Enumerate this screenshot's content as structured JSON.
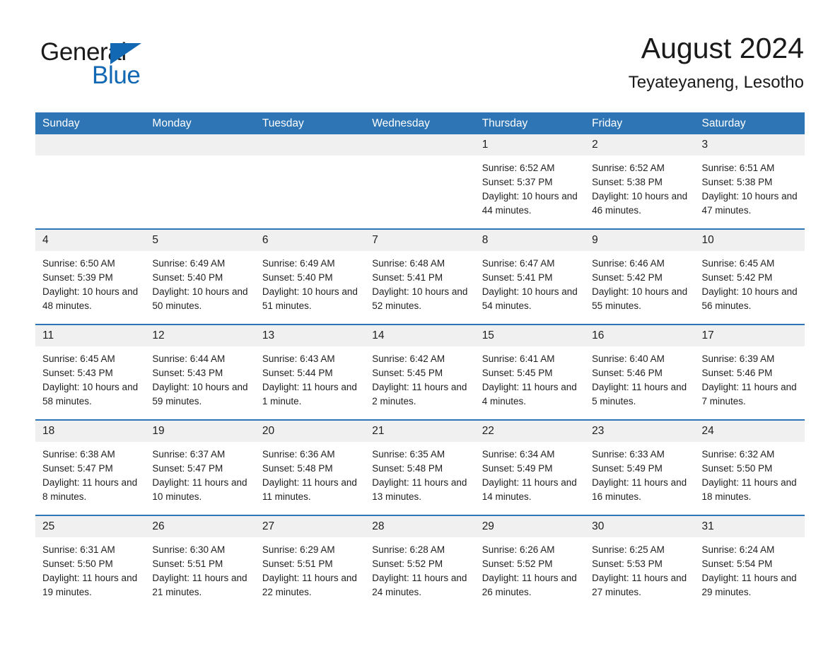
{
  "logo": {
    "word_one": "General",
    "word_two": "Blue",
    "triangle_color": "#1268b3",
    "text_color": "#1a1a1a"
  },
  "header": {
    "title": "August 2024",
    "subtitle": "Teyateyaneng, Lesotho"
  },
  "theme": {
    "header_blue": "#2e75b6",
    "daynum_band": "#f0f0f0",
    "cell_background": "#ffffff",
    "text": "#1f1f1f"
  },
  "weekday_headers": [
    "Sunday",
    "Monday",
    "Tuesday",
    "Wednesday",
    "Thursday",
    "Friday",
    "Saturday"
  ],
  "weeks": [
    [
      {
        "day": "",
        "sunrise": "",
        "sunset": "",
        "daylight": ""
      },
      {
        "day": "",
        "sunrise": "",
        "sunset": "",
        "daylight": ""
      },
      {
        "day": "",
        "sunrise": "",
        "sunset": "",
        "daylight": ""
      },
      {
        "day": "",
        "sunrise": "",
        "sunset": "",
        "daylight": ""
      },
      {
        "day": "1",
        "sunrise": "Sunrise: 6:52 AM",
        "sunset": "Sunset: 5:37 PM",
        "daylight": "Daylight: 10 hours and 44 minutes."
      },
      {
        "day": "2",
        "sunrise": "Sunrise: 6:52 AM",
        "sunset": "Sunset: 5:38 PM",
        "daylight": "Daylight: 10 hours and 46 minutes."
      },
      {
        "day": "3",
        "sunrise": "Sunrise: 6:51 AM",
        "sunset": "Sunset: 5:38 PM",
        "daylight": "Daylight: 10 hours and 47 minutes."
      }
    ],
    [
      {
        "day": "4",
        "sunrise": "Sunrise: 6:50 AM",
        "sunset": "Sunset: 5:39 PM",
        "daylight": "Daylight: 10 hours and 48 minutes."
      },
      {
        "day": "5",
        "sunrise": "Sunrise: 6:49 AM",
        "sunset": "Sunset: 5:40 PM",
        "daylight": "Daylight: 10 hours and 50 minutes."
      },
      {
        "day": "6",
        "sunrise": "Sunrise: 6:49 AM",
        "sunset": "Sunset: 5:40 PM",
        "daylight": "Daylight: 10 hours and 51 minutes."
      },
      {
        "day": "7",
        "sunrise": "Sunrise: 6:48 AM",
        "sunset": "Sunset: 5:41 PM",
        "daylight": "Daylight: 10 hours and 52 minutes."
      },
      {
        "day": "8",
        "sunrise": "Sunrise: 6:47 AM",
        "sunset": "Sunset: 5:41 PM",
        "daylight": "Daylight: 10 hours and 54 minutes."
      },
      {
        "day": "9",
        "sunrise": "Sunrise: 6:46 AM",
        "sunset": "Sunset: 5:42 PM",
        "daylight": "Daylight: 10 hours and 55 minutes."
      },
      {
        "day": "10",
        "sunrise": "Sunrise: 6:45 AM",
        "sunset": "Sunset: 5:42 PM",
        "daylight": "Daylight: 10 hours and 56 minutes."
      }
    ],
    [
      {
        "day": "11",
        "sunrise": "Sunrise: 6:45 AM",
        "sunset": "Sunset: 5:43 PM",
        "daylight": "Daylight: 10 hours and 58 minutes."
      },
      {
        "day": "12",
        "sunrise": "Sunrise: 6:44 AM",
        "sunset": "Sunset: 5:43 PM",
        "daylight": "Daylight: 10 hours and 59 minutes."
      },
      {
        "day": "13",
        "sunrise": "Sunrise: 6:43 AM",
        "sunset": "Sunset: 5:44 PM",
        "daylight": "Daylight: 11 hours and 1 minute."
      },
      {
        "day": "14",
        "sunrise": "Sunrise: 6:42 AM",
        "sunset": "Sunset: 5:45 PM",
        "daylight": "Daylight: 11 hours and 2 minutes."
      },
      {
        "day": "15",
        "sunrise": "Sunrise: 6:41 AM",
        "sunset": "Sunset: 5:45 PM",
        "daylight": "Daylight: 11 hours and 4 minutes."
      },
      {
        "day": "16",
        "sunrise": "Sunrise: 6:40 AM",
        "sunset": "Sunset: 5:46 PM",
        "daylight": "Daylight: 11 hours and 5 minutes."
      },
      {
        "day": "17",
        "sunrise": "Sunrise: 6:39 AM",
        "sunset": "Sunset: 5:46 PM",
        "daylight": "Daylight: 11 hours and 7 minutes."
      }
    ],
    [
      {
        "day": "18",
        "sunrise": "Sunrise: 6:38 AM",
        "sunset": "Sunset: 5:47 PM",
        "daylight": "Daylight: 11 hours and 8 minutes."
      },
      {
        "day": "19",
        "sunrise": "Sunrise: 6:37 AM",
        "sunset": "Sunset: 5:47 PM",
        "daylight": "Daylight: 11 hours and 10 minutes."
      },
      {
        "day": "20",
        "sunrise": "Sunrise: 6:36 AM",
        "sunset": "Sunset: 5:48 PM",
        "daylight": "Daylight: 11 hours and 11 minutes."
      },
      {
        "day": "21",
        "sunrise": "Sunrise: 6:35 AM",
        "sunset": "Sunset: 5:48 PM",
        "daylight": "Daylight: 11 hours and 13 minutes."
      },
      {
        "day": "22",
        "sunrise": "Sunrise: 6:34 AM",
        "sunset": "Sunset: 5:49 PM",
        "daylight": "Daylight: 11 hours and 14 minutes."
      },
      {
        "day": "23",
        "sunrise": "Sunrise: 6:33 AM",
        "sunset": "Sunset: 5:49 PM",
        "daylight": "Daylight: 11 hours and 16 minutes."
      },
      {
        "day": "24",
        "sunrise": "Sunrise: 6:32 AM",
        "sunset": "Sunset: 5:50 PM",
        "daylight": "Daylight: 11 hours and 18 minutes."
      }
    ],
    [
      {
        "day": "25",
        "sunrise": "Sunrise: 6:31 AM",
        "sunset": "Sunset: 5:50 PM",
        "daylight": "Daylight: 11 hours and 19 minutes."
      },
      {
        "day": "26",
        "sunrise": "Sunrise: 6:30 AM",
        "sunset": "Sunset: 5:51 PM",
        "daylight": "Daylight: 11 hours and 21 minutes."
      },
      {
        "day": "27",
        "sunrise": "Sunrise: 6:29 AM",
        "sunset": "Sunset: 5:51 PM",
        "daylight": "Daylight: 11 hours and 22 minutes."
      },
      {
        "day": "28",
        "sunrise": "Sunrise: 6:28 AM",
        "sunset": "Sunset: 5:52 PM",
        "daylight": "Daylight: 11 hours and 24 minutes."
      },
      {
        "day": "29",
        "sunrise": "Sunrise: 6:26 AM",
        "sunset": "Sunset: 5:52 PM",
        "daylight": "Daylight: 11 hours and 26 minutes."
      },
      {
        "day": "30",
        "sunrise": "Sunrise: 6:25 AM",
        "sunset": "Sunset: 5:53 PM",
        "daylight": "Daylight: 11 hours and 27 minutes."
      },
      {
        "day": "31",
        "sunrise": "Sunrise: 6:24 AM",
        "sunset": "Sunset: 5:54 PM",
        "daylight": "Daylight: 11 hours and 29 minutes."
      }
    ]
  ]
}
